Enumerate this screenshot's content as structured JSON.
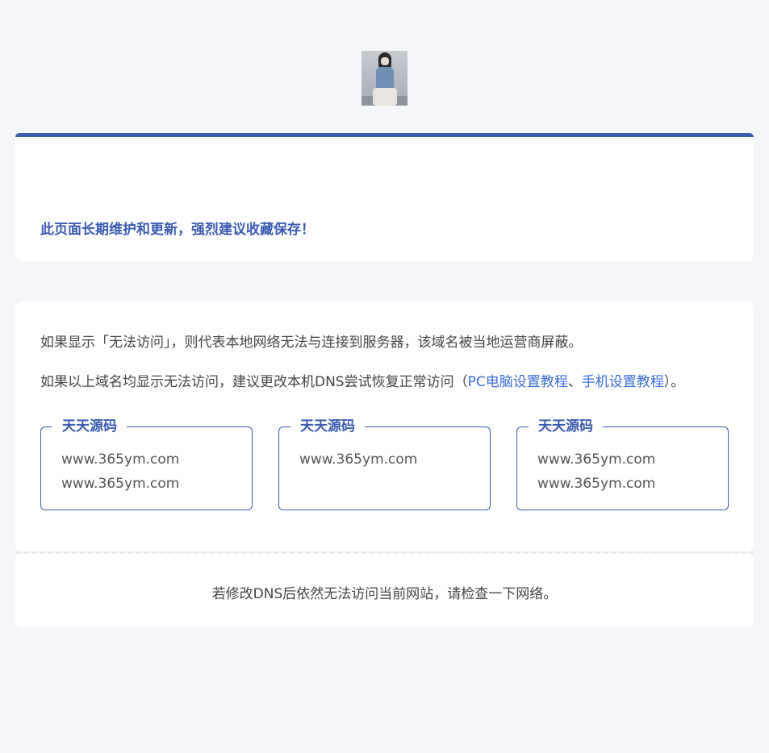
{
  "notice": {
    "text": "此页面长期维护和更新，强烈建议收藏保存！"
  },
  "main": {
    "line1": "如果显示「无法访问」，则代表本地网络无法与连接到服务器，该域名被当地运营商屏蔽。",
    "line2_prefix": "如果以上域名均显示无法访问，建议更改本机DNS尝试恢复正常访问（",
    "pc_link": "PC电脑设置教程",
    "separator": "、",
    "mobile_link": "手机设置教程",
    "line2_suffix": "）。",
    "boxes": [
      {
        "title": "天天源码",
        "links": [
          "www.365ym.com",
          "www.365ym.com"
        ]
      },
      {
        "title": "天天源码",
        "links": [
          "www.365ym.com"
        ]
      },
      {
        "title": "天天源码",
        "links": [
          "www.365ym.com",
          "www.365ym.com"
        ]
      }
    ]
  },
  "footer": {
    "text": "若修改DNS后依然无法访问当前网站，请检查一下网络。"
  },
  "colors": {
    "accent": "#3a5bb0",
    "link": "#3a6dd8",
    "background": "#f5f6fa"
  }
}
